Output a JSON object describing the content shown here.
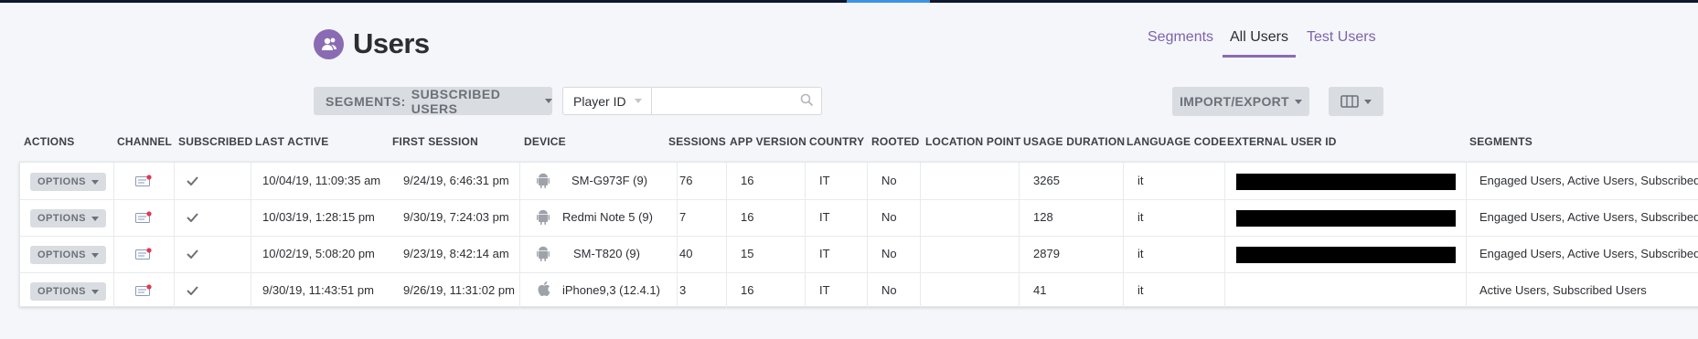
{
  "page": {
    "title": "Users",
    "icon": "users-icon"
  },
  "tabs": [
    "Segments",
    "All Users",
    "Test Users"
  ],
  "active_tab": "All Users",
  "toolbar": {
    "segments_prefix": "SEGMENTS:",
    "segments_value": "SUBSCRIBED USERS",
    "filter_field": "Player ID",
    "search_placeholder": "",
    "import_export": "IMPORT/EXPORT"
  },
  "columns": [
    "ACTIONS",
    "CHANNEL",
    "SUBSCRIBED",
    "LAST ACTIVE",
    "FIRST SESSION",
    "DEVICE",
    "SESSIONS",
    "APP VERSION",
    "COUNTRY",
    "ROOTED",
    "LOCATION POINT",
    "USAGE DURATION",
    "LANGUAGE CODE",
    "EXTERNAL USER ID",
    "SEGMENTS"
  ],
  "options_label": "OPTIONS",
  "rows": [
    {
      "last_active": "10/04/19, 11:09:35 am",
      "first_session": "9/24/19, 6:46:31 pm",
      "device_icon": "android-icon",
      "device": "SM-G973F (9)",
      "sessions": "76",
      "app_version": "16",
      "country": "IT",
      "rooted": "No",
      "location": "",
      "usage": "3265",
      "lang": "it",
      "ext_redacted": true,
      "segments": "Engaged Users, Active Users, Subscribed"
    },
    {
      "last_active": "10/03/19, 1:28:15 pm",
      "first_session": "9/30/19, 7:24:03 pm",
      "device_icon": "android-icon",
      "device": "Redmi Note 5 (9)",
      "sessions": "7",
      "app_version": "16",
      "country": "IT",
      "rooted": "No",
      "location": "",
      "usage": "128",
      "lang": "it",
      "ext_redacted": true,
      "segments": "Engaged Users, Active Users, Subscribed"
    },
    {
      "last_active": "10/02/19, 5:08:20 pm",
      "first_session": "9/23/19, 8:42:14 am",
      "device_icon": "android-icon",
      "device": "SM-T820 (9)",
      "sessions": "40",
      "app_version": "15",
      "country": "IT",
      "rooted": "No",
      "location": "",
      "usage": "2879",
      "lang": "it",
      "ext_redacted": true,
      "segments": "Engaged Users, Active Users, Subscribed"
    },
    {
      "last_active": "9/30/19, 11:43:51 pm",
      "first_session": "9/26/19, 11:31:02 pm",
      "device_icon": "apple-icon",
      "device": "iPhone9,3 (12.4.1)",
      "sessions": "3",
      "app_version": "16",
      "country": "IT",
      "rooted": "No",
      "location": "",
      "usage": "41",
      "lang": "it",
      "ext_redacted": false,
      "segments": "Active Users, Subscribed Users"
    }
  ]
}
